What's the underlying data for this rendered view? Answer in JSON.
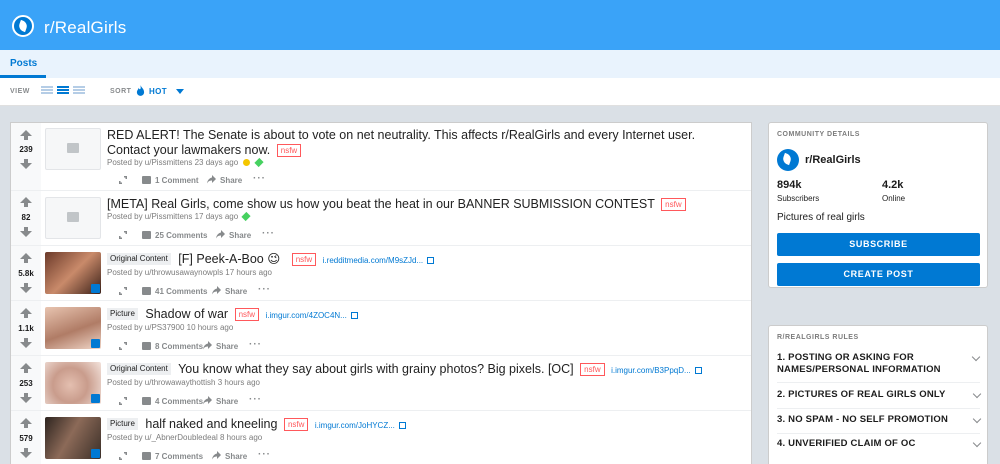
{
  "header": {
    "subreddit": "r/RealGirls"
  },
  "tabs": [
    {
      "label": "Posts"
    }
  ],
  "viewbar": {
    "view_label": "VIEW",
    "sort_label": "SORT",
    "sort_value": "HOT"
  },
  "posts": [
    {
      "score": "239",
      "flair": "",
      "title": "RED ALERT! The Senate is about to vote on net neutrality. This affects r/RealGirls and every Internet user. Contact your lawmakers now.",
      "nsfw": "nsfw",
      "domain": "",
      "meta": "Posted by u/Pissmittens 23 days ago",
      "comments": "1 Comment",
      "share": "Share",
      "thumb": "self"
    },
    {
      "score": "82",
      "flair": "",
      "title": "[META] Real Girls, come show us how you beat the heat in our BANNER SUBMISSION CONTEST",
      "nsfw": "nsfw",
      "domain": "",
      "meta": "Posted by u/Pissmittens 17 days ago",
      "comments": "25 Comments",
      "share": "Share",
      "thumb": "self"
    },
    {
      "score": "5.8k",
      "flair": "Original Content",
      "title": "[F] Peek-A-Boo 😉",
      "nsfw": "nsfw",
      "domain": "i.redditmedia.com/M9sZJd...",
      "meta": "Posted by u/throwusawaynowpls 17 hours ago",
      "comments": "41 Comments",
      "share": "Share",
      "thumb": "img"
    },
    {
      "score": "1.1k",
      "flair": "Picture",
      "title": "Shadow of war",
      "nsfw": "nsfw",
      "domain": "i.imgur.com/4ZOC4N...",
      "meta": "Posted by u/PS37900 10 hours ago",
      "comments": "8 Comments",
      "share": "Share",
      "thumb": "img"
    },
    {
      "score": "253",
      "flair": "Original Content",
      "title": "You know what they say about girls with grainy photos? Big pixels. [OC]",
      "nsfw": "nsfw",
      "domain": "i.imgur.com/B3PpqD...",
      "meta": "Posted by u/throwawaythottish 3 hours ago",
      "comments": "4 Comments",
      "share": "Share",
      "thumb": "img"
    },
    {
      "score": "579",
      "flair": "Picture",
      "title": "half naked and kneeling",
      "nsfw": "nsfw",
      "domain": "i.imgur.com/JoHYCZ...",
      "meta": "Posted by u/_AbnerDoubledeal 8 hours ago",
      "comments": "7 Comments",
      "share": "Share",
      "thumb": "img"
    }
  ],
  "community": {
    "heading": "COMMUNITY DETAILS",
    "name": "r/RealGirls",
    "subscribers": "894k",
    "subscribers_label": "Subscribers",
    "online": "4.2k",
    "online_label": "Online",
    "description": "Pictures of real girls",
    "subscribe_label": "SUBSCRIBE",
    "create_label": "CREATE POST"
  },
  "rules": {
    "heading": "R/REALGIRLS RULES",
    "items": [
      "1. POSTING OR ASKING FOR NAMES/PERSONAL INFORMATION",
      "2. PICTURES OF REAL GIRLS ONLY",
      "3. NO SPAM - NO SELF PROMOTION",
      "4. UNVERIFIED CLAIM OF OC"
    ]
  },
  "colors": {
    "accent": "#0079d3",
    "banner": "#3aa3f8",
    "nsfw": "#ff585b"
  }
}
